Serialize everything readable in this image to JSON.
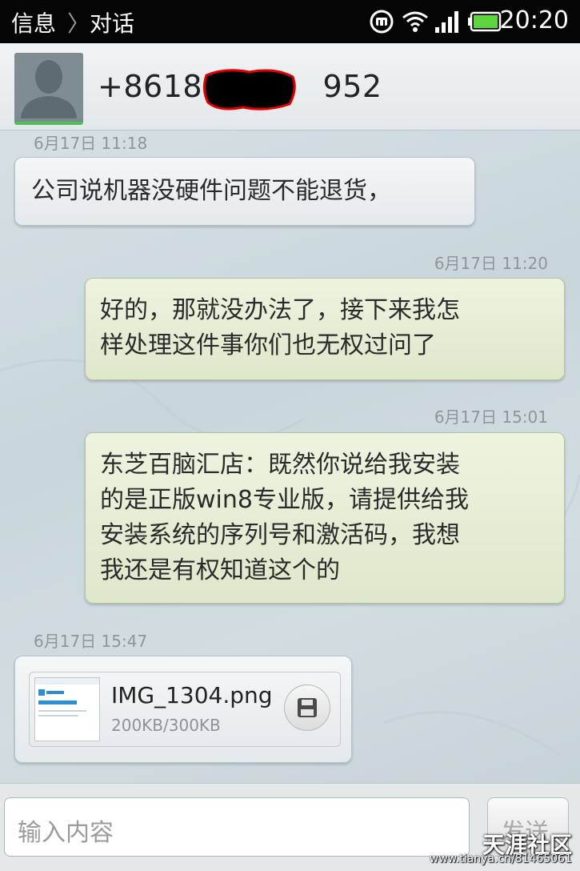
{
  "status_bar": {
    "breadcrumb_root": "信息",
    "breadcrumb_sep": "〉",
    "breadcrumb_current": "对话",
    "icons": [
      "mi-notification-icon",
      "wifi-icon",
      "signal-icon",
      "battery-icon"
    ],
    "time": "20:20"
  },
  "header": {
    "contact_number": "+86186          952",
    "avatar_icon": "default-contact-avatar"
  },
  "messages": [
    {
      "direction": "incoming",
      "timestamp": "6月17日 11:18",
      "lines": [
        "公司说机器没硬件问题不能退货，"
      ]
    },
    {
      "direction": "outgoing",
      "timestamp": "6月17日 11:20",
      "lines": [
        "好的，那就没办法了，接下来我怎",
        "样处理这件事你们也无权过问了"
      ]
    },
    {
      "direction": "outgoing",
      "timestamp": "6月17日 15:01",
      "lines": [
        "东芝百脑汇店：既然你说给我安装",
        "的是正版win8专业版，请提供给我",
        "安装系统的序列号和激活码，我想",
        "我还是有权知道这个的"
      ]
    },
    {
      "direction": "incoming",
      "timestamp": "6月17日 15:47",
      "attachment": {
        "filename": "IMG_1304.png",
        "size": "200KB/300KB",
        "icon": "save-icon"
      }
    }
  ],
  "input": {
    "placeholder": "输入内容",
    "send_label": "发送"
  },
  "watermark": {
    "brand": "天涯社区",
    "url": "www.tianya.cn/81465061"
  },
  "colors": {
    "status_bar_bg": "#050505",
    "incoming_bubble": "#e8ecee",
    "outgoing_bubble": "#e4eccf",
    "chat_bg": "#cfdbe0",
    "battery_green": "#5cd63c"
  }
}
